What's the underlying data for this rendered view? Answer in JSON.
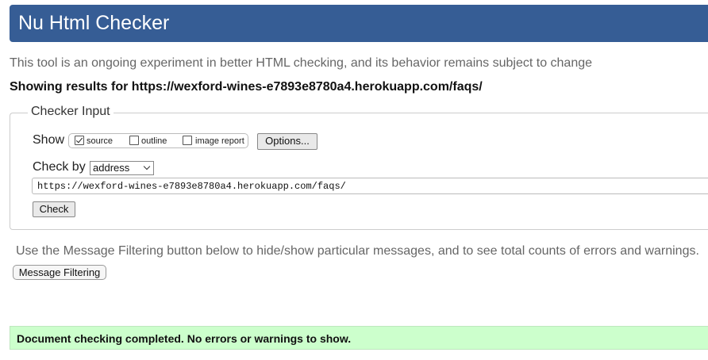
{
  "header": {
    "title": "Nu Html Checker"
  },
  "tagline": "This tool is an ongoing experiment in better HTML checking, and its behavior remains subject to change",
  "showing_results": "Showing results for https://wexford-wines-e7893e8780a4.herokuapp.com/faqs/",
  "checker_input": {
    "legend": "Checker Input",
    "show_label": "Show",
    "options": [
      {
        "label": "source",
        "checked": true
      },
      {
        "label": "outline",
        "checked": false
      },
      {
        "label": "image report",
        "checked": false
      }
    ],
    "options_button": "Options...",
    "check_by_label": "Check by",
    "check_by_value": "address",
    "url_value": "https://wexford-wines-e7893e8780a4.herokuapp.com/faqs/",
    "check_button": "Check"
  },
  "filtering": {
    "note": "Use the Message Filtering button below to hide/show particular messages, and to see total counts of errors and warnings.",
    "button": "Message Filtering"
  },
  "result": {
    "message": "Document checking completed. No errors or warnings to show."
  },
  "colors": {
    "header_bg": "#365d95",
    "success_bg": "#ccffcc"
  }
}
